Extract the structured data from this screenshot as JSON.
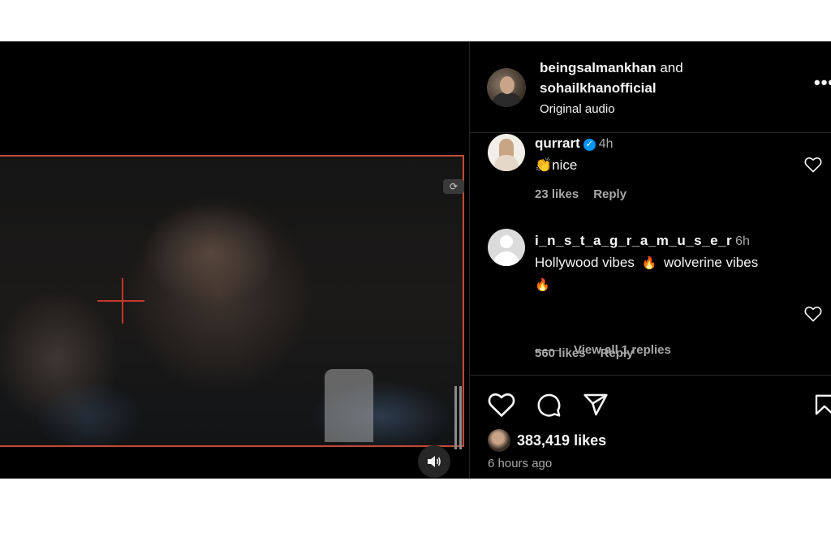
{
  "post": {
    "author_primary": "beingsalmankhan",
    "conjunction": "and",
    "author_secondary": "sohailkhanofficial",
    "audio_label": "Original audio",
    "more_label": "•••"
  },
  "comments": [
    {
      "username": "qurrart",
      "verified": true,
      "time": "4h",
      "emoji": "👏",
      "text": "nice",
      "likes": "23 likes",
      "reply": "Reply"
    },
    {
      "username": "i_n_s_t_a_g_r_a_m_u_s_e_r",
      "verified": false,
      "time": "6h",
      "text_part1": "Hollywood vibes",
      "emoji1": "🔥",
      "text_part2": "wolverine vibes",
      "emoji2": "🔥",
      "likes": "560 likes",
      "reply": "Reply",
      "view_replies": "View all 1 replies"
    }
  ],
  "engagement": {
    "likes": "383,419 likes",
    "timestamp": "6 hours ago"
  },
  "icons": {
    "like": "heart-icon",
    "comment": "comment-icon",
    "share": "share-icon",
    "save": "bookmark-icon",
    "mute": "speaker-icon",
    "verified": "verified-badge-icon"
  },
  "colors": {
    "background": "#000000",
    "text": "#f5f5f5",
    "muted_text": "#a8a8a8",
    "verified": "#0095f6",
    "video_frame": "#c24a36"
  }
}
